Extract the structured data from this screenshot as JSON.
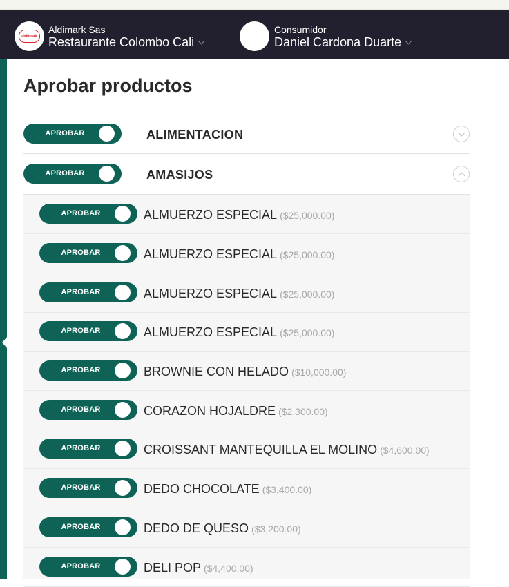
{
  "header": {
    "company_small": "Aldimark Sas",
    "company_name": "Restaurante Colombo Cali",
    "logo_text": "aldimark",
    "consumer_small": "Consumidor",
    "consumer_name": "Daniel Cardona Duarte"
  },
  "page": {
    "title": "Aprobar productos"
  },
  "toggle_label": "APROBAR",
  "categories": [
    {
      "label": "ALIMENTACION",
      "expanded": false
    },
    {
      "label": "AMASIJOS",
      "expanded": true
    }
  ],
  "products": [
    {
      "name": "ALMUERZO ESPECIAL",
      "price": "($25,000.00)"
    },
    {
      "name": "ALMUERZO ESPECIAL",
      "price": "($25,000.00)"
    },
    {
      "name": "ALMUERZO ESPECIAL",
      "price": "($25,000.00)"
    },
    {
      "name": "ALMUERZO ESPECIAL",
      "price": "($25,000.00)"
    },
    {
      "name": "BROWNIE CON HELADO",
      "price": "($10,000.00)"
    },
    {
      "name": "CORAZON HOJALDRE",
      "price": "($2,300.00)"
    },
    {
      "name": "CROISSANT MANTEQUILLA EL MOLINO",
      "price": "($4,600.00)"
    },
    {
      "name": "DEDO CHOCOLATE",
      "price": "($3,400.00)"
    },
    {
      "name": "DEDO DE QUESO",
      "price": "($3,200.00)"
    },
    {
      "name": "DELI POP",
      "price": "($4,400.00)"
    }
  ],
  "colors": {
    "header_bg": "#221f2e",
    "accent": "#0e6356",
    "brand_red": "#d9262a"
  }
}
